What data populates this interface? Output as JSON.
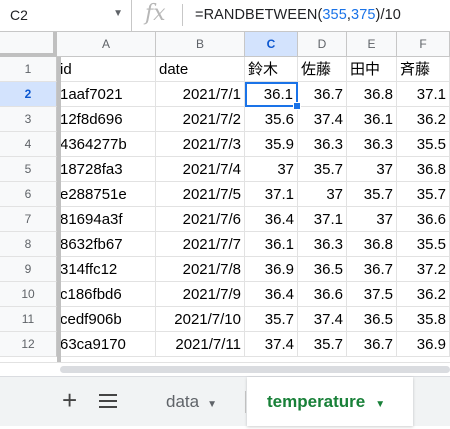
{
  "formula_bar": {
    "name_box": "C2",
    "fx": "fx",
    "formula_prefix": "=RANDBETWEEN(",
    "arg1": "355",
    "comma": ",",
    "arg2": "375",
    "formula_suffix": ")/10"
  },
  "columns": [
    "A",
    "B",
    "C",
    "D",
    "E",
    "F"
  ],
  "rows": [
    {
      "n": "1",
      "id": "id",
      "date": "date",
      "c": "鈴木",
      "d": "佐藤",
      "e": "田中",
      "f": "斉藤"
    },
    {
      "n": "2",
      "id": "1aaf7021",
      "date": "2021/7/1",
      "c": "36.1",
      "d": "36.7",
      "e": "36.8",
      "f": "37.1"
    },
    {
      "n": "3",
      "id": "12f8d696",
      "date": "2021/7/2",
      "c": "35.6",
      "d": "37.4",
      "e": "36.1",
      "f": "36.2"
    },
    {
      "n": "4",
      "id": "4364277b",
      "date": "2021/7/3",
      "c": "35.9",
      "d": "36.3",
      "e": "36.3",
      "f": "35.5"
    },
    {
      "n": "5",
      "id": "18728fa3",
      "date": "2021/7/4",
      "c": "37",
      "d": "35.7",
      "e": "37",
      "f": "36.8"
    },
    {
      "n": "6",
      "id": "e288751e",
      "date": "2021/7/5",
      "c": "37.1",
      "d": "37",
      "e": "35.7",
      "f": "35.7"
    },
    {
      "n": "7",
      "id": "81694a3f",
      "date": "2021/7/6",
      "c": "36.4",
      "d": "37.1",
      "e": "37",
      "f": "36.6"
    },
    {
      "n": "8",
      "id": "8632fb67",
      "date": "2021/7/7",
      "c": "36.1",
      "d": "36.3",
      "e": "36.8",
      "f": "35.5"
    },
    {
      "n": "9",
      "id": "314ffc12",
      "date": "2021/7/8",
      "c": "36.9",
      "d": "36.5",
      "e": "36.7",
      "f": "37.2"
    },
    {
      "n": "10",
      "id": "c186fbd6",
      "date": "2021/7/9",
      "c": "36.4",
      "d": "36.6",
      "e": "37.5",
      "f": "36.2"
    },
    {
      "n": "11",
      "id": "cedf906b",
      "date": "2021/7/10",
      "c": "35.7",
      "d": "37.4",
      "e": "36.5",
      "f": "35.8"
    },
    {
      "n": "12",
      "id": "63ca9170",
      "date": "2021/7/11",
      "c": "37.4",
      "d": "35.7",
      "e": "36.7",
      "f": "36.9"
    }
  ],
  "sheets": {
    "add": "+",
    "tab1": "data",
    "tab2": "temperature",
    "caret": "▼"
  },
  "colors": {
    "accent": "#1a73e8",
    "active_tab": "#188038",
    "header_sel": "#d3e3fd"
  }
}
